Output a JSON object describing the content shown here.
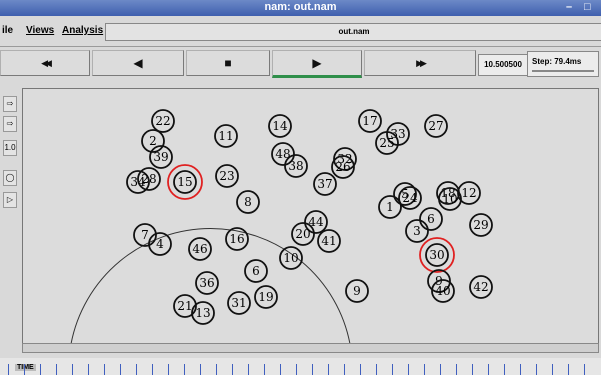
{
  "window": {
    "title": "nam: out.nam",
    "minimize_glyph": "–",
    "maximize_glyph": "□"
  },
  "menu": {
    "file": "ile",
    "views": "Views",
    "analysis": "Analysis"
  },
  "file_field": {
    "value": "out.nam"
  },
  "toolbar": {
    "rewind_glyph": "◀◀",
    "back_glyph": "◀",
    "stop_glyph": "■",
    "play_glyph": "▶",
    "ff_glyph": "▶▶",
    "time_value": "10.500500",
    "step_label": "Step: 79.4ms"
  },
  "left_tools": [
    "⇨",
    "⇨",
    "1.0",
    "◯",
    "▷"
  ],
  "timeline_label": "TIME",
  "nodes": [
    {
      "id": "22",
      "highlight": false
    },
    {
      "id": "2",
      "highlight": false
    },
    {
      "id": "39",
      "highlight": false
    },
    {
      "id": "34",
      "highlight": false
    },
    {
      "id": "28",
      "highlight": false
    },
    {
      "id": "15",
      "highlight": true
    },
    {
      "id": "11",
      "highlight": false
    },
    {
      "id": "23",
      "highlight": false
    },
    {
      "id": "8",
      "highlight": false
    },
    {
      "id": "14",
      "highlight": false
    },
    {
      "id": "48",
      "highlight": false
    },
    {
      "id": "38",
      "highlight": false
    },
    {
      "id": "37",
      "highlight": false
    },
    {
      "id": "32",
      "highlight": false
    },
    {
      "id": "26",
      "highlight": false
    },
    {
      "id": "17",
      "highlight": false
    },
    {
      "id": "33",
      "highlight": false
    },
    {
      "id": "25",
      "highlight": false
    },
    {
      "id": "27",
      "highlight": false
    },
    {
      "id": "1",
      "highlight": false
    },
    {
      "id": "5",
      "highlight": false
    },
    {
      "id": "24",
      "highlight": false
    },
    {
      "id": "18",
      "highlight": false
    },
    {
      "id": "10",
      "highlight": false
    },
    {
      "id": "12",
      "highlight": false
    },
    {
      "id": "29",
      "highlight": false
    },
    {
      "id": "6",
      "highlight": false
    },
    {
      "id": "3",
      "highlight": false
    },
    {
      "id": "30",
      "highlight": true
    },
    {
      "id": "7",
      "highlight": false
    },
    {
      "id": "4",
      "highlight": false
    },
    {
      "id": "46",
      "highlight": false
    },
    {
      "id": "16",
      "highlight": false
    },
    {
      "id": "44",
      "highlight": false
    },
    {
      "id": "20",
      "highlight": false
    },
    {
      "id": "41",
      "highlight": false
    },
    {
      "id": "10",
      "highlight": false
    },
    {
      "id": "6",
      "highlight": false
    },
    {
      "id": "36",
      "highlight": false
    },
    {
      "id": "21",
      "highlight": false
    },
    {
      "id": "13",
      "highlight": false
    },
    {
      "id": "31",
      "highlight": false
    },
    {
      "id": "19",
      "highlight": false
    },
    {
      "id": "9",
      "highlight": false
    },
    {
      "id": "9",
      "highlight": false
    },
    {
      "id": "40",
      "highlight": false
    },
    {
      "id": "42",
      "highlight": false
    }
  ],
  "colors": {
    "highlight": "#e02020",
    "accent": "#2f8f4a",
    "titlebar": "#3f5fae"
  }
}
